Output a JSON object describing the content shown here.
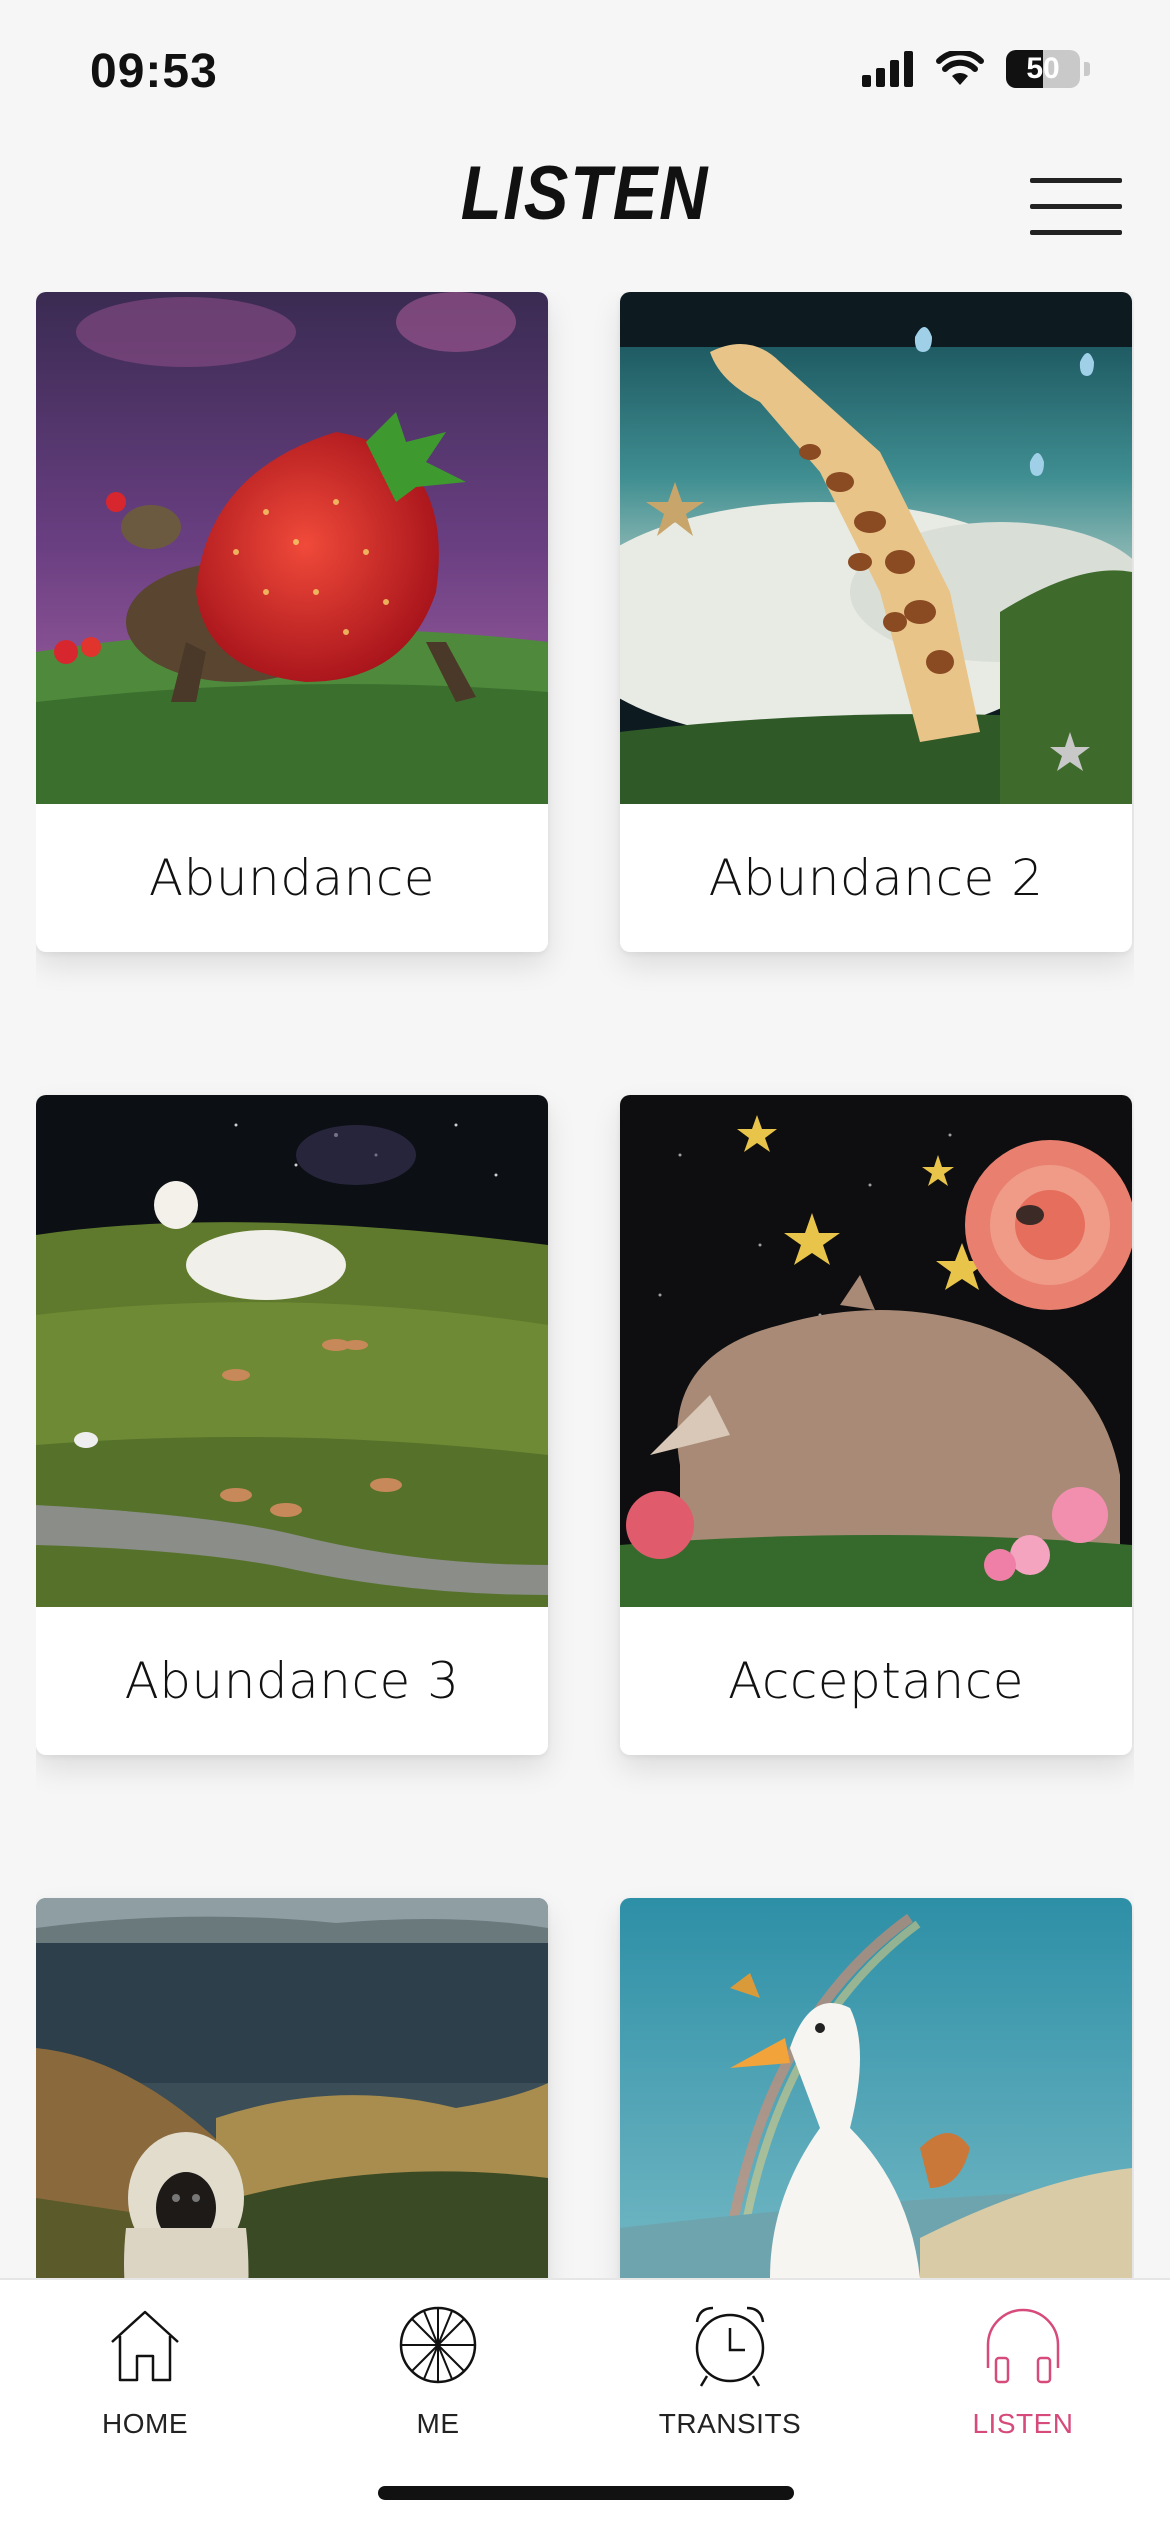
{
  "status_bar": {
    "time": "09:53",
    "battery_level": "50",
    "battery_fraction": 0.5
  },
  "header": {
    "title": "LISTEN",
    "menu_icon": "hamburger-menu-icon"
  },
  "cards": [
    {
      "label": "Abundance",
      "art": "strawberry-turtle-collage"
    },
    {
      "label": "Abundance 2",
      "art": "giraffe-waterfall-collage"
    },
    {
      "label": "Abundance 3",
      "art": "cow-meadow-collage"
    },
    {
      "label": "Acceptance",
      "art": "rhino-rose-collage"
    },
    {
      "label": "",
      "art": "monkey-mountains-collage"
    },
    {
      "label": "",
      "art": "duck-rainbow-collage"
    }
  ],
  "nav": {
    "items": [
      {
        "label": "HOME",
        "icon": "house-icon"
      },
      {
        "label": "ME",
        "icon": "wheel-icon"
      },
      {
        "label": "TRANSITS",
        "icon": "alarm-clock-icon"
      },
      {
        "label": "LISTEN",
        "icon": "headphones-icon"
      }
    ],
    "active": "LISTEN"
  },
  "colors": {
    "accent": "#d64b7c",
    "background": "#f6f6f6",
    "text": "#111111"
  }
}
